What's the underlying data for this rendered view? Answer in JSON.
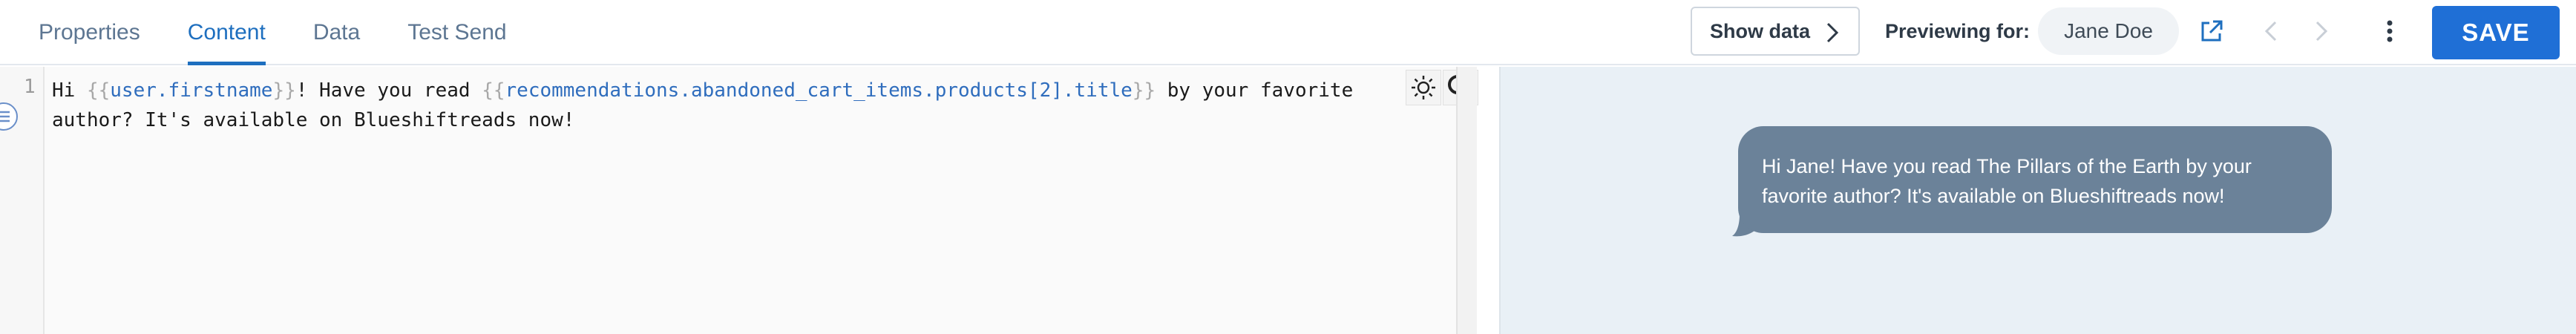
{
  "tabs": [
    {
      "label": "Properties",
      "active": false
    },
    {
      "label": "Content",
      "active": true
    },
    {
      "label": "Data",
      "active": false
    },
    {
      "label": "Test Send",
      "active": false
    }
  ],
  "toolbar": {
    "show_data_label": "Show data",
    "previewing_label": "Previewing for:",
    "preview_user": "Jane Doe",
    "save_label": "SAVE"
  },
  "editor": {
    "line_number": "1",
    "line1_pre": "Hi ",
    "line1_brace_open1": "{{",
    "line1_var1": "user.firstname",
    "line1_brace_close1": "}}",
    "line1_mid": "! Have you read ",
    "line1_brace_open2": "{{",
    "line1_var2": "recommendations.abandoned_cart_items.products[2].title",
    "line1_brace_close2": "}}",
    "line1_post": " by your favorite author? It's available on Blueshiftreads now!"
  },
  "preview": {
    "message": "Hi Jane! Have you read The Pillars of the Earth by your favorite author? It's available on Blueshiftreads now!"
  },
  "colors": {
    "accent": "#1e6fbf",
    "save_button": "#1f6fd6",
    "bubble": "#6b8299",
    "preview_bg": "#e9f0f6",
    "template_var": "#2f6dbd"
  }
}
